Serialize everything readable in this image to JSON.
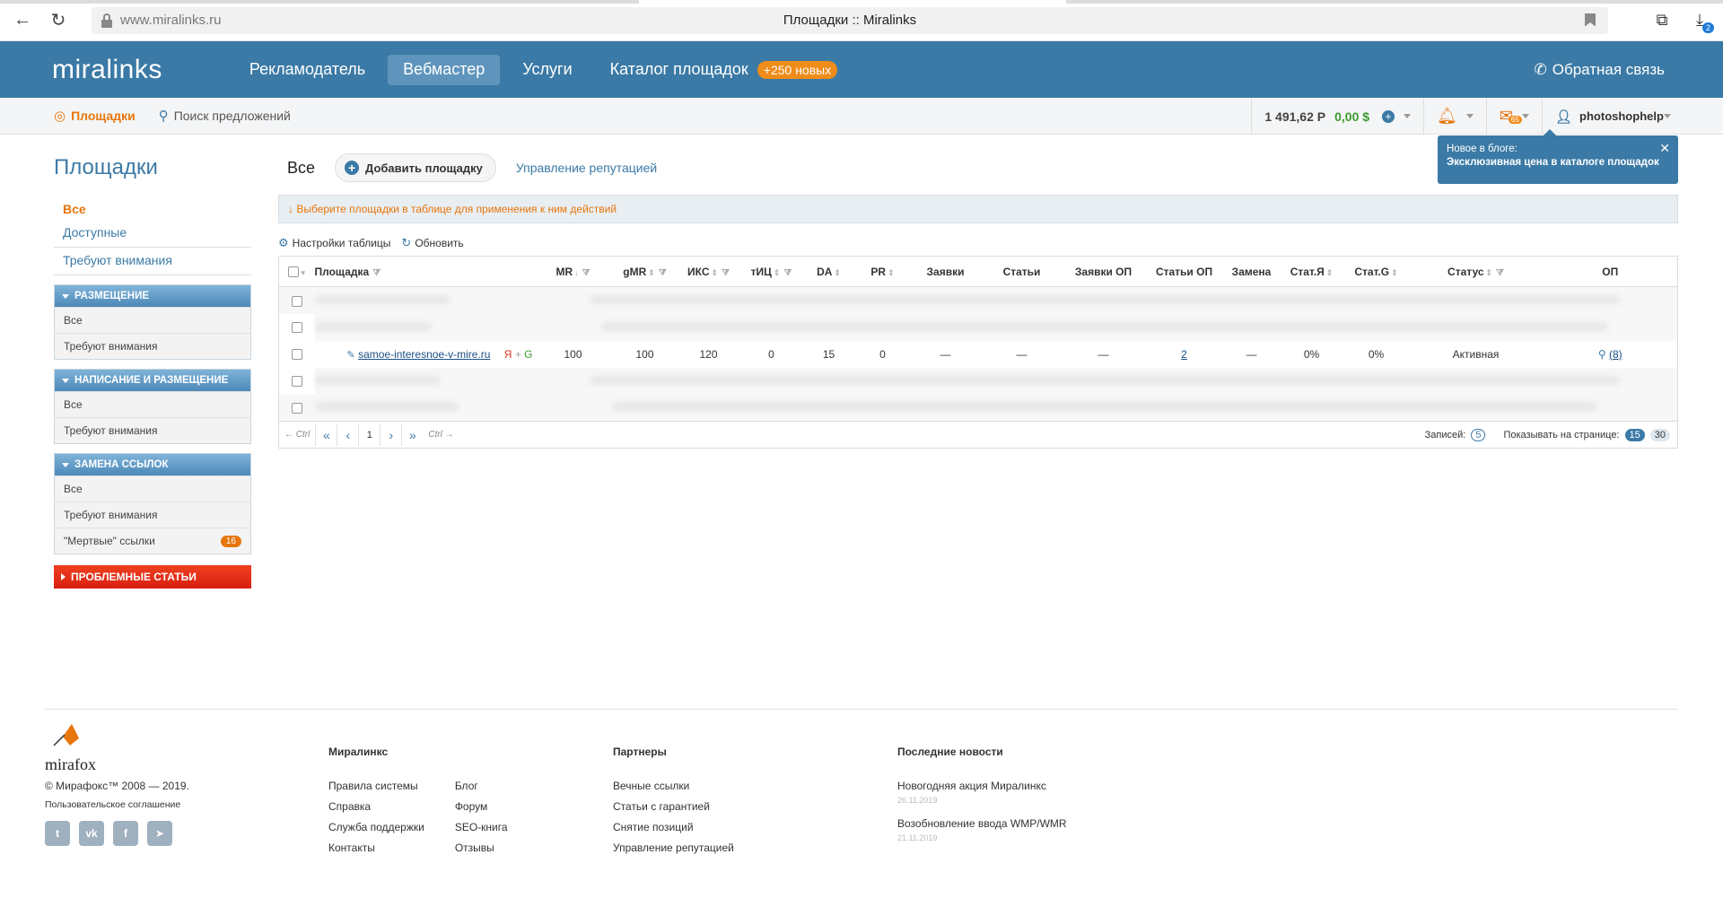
{
  "browser": {
    "url": "www.miralinks.ru",
    "title": "Площадки :: Miralinks",
    "download_count": "2"
  },
  "topnav": {
    "logo": "miralinks",
    "items": [
      {
        "label": "Рекламодатель"
      },
      {
        "label": "Вебмастер"
      },
      {
        "label": "Услуги"
      },
      {
        "label": "Каталог площадок"
      }
    ],
    "new_badge": "+250 новых",
    "feedback": "Обратная связь"
  },
  "subnav": {
    "places": "Площадки",
    "search": "Поиск предложений",
    "balance_rub": "1 491,62 Р",
    "balance_usd": "0,00 $",
    "mail_count": "65",
    "user": "photoshophelp"
  },
  "blog_popup": {
    "line1": "Новое в блоге:",
    "line2": "Эксклюзивная цена в каталоге площадок",
    "close": "✕"
  },
  "sidebar": {
    "title": "Площадки",
    "links": [
      "Все",
      "Доступные",
      "Требуют внимания"
    ],
    "groups": [
      {
        "title": "Размещение",
        "rows": [
          "Все",
          "Требуют внимания"
        ]
      },
      {
        "title": "Написание и размещение",
        "rows": [
          "Все",
          "Требуют внимания"
        ]
      },
      {
        "title": "Замена ссылок",
        "rows": [
          "Все",
          "Требуют внимания",
          "\"Мертвые\" ссылки"
        ],
        "dead_count": "16"
      }
    ],
    "problem": "Проблемные статьи"
  },
  "main": {
    "tab_all": "Все",
    "add_button": "Добавить площадку",
    "reputation": "Управление репутацией",
    "hint": "↓ Выберите площадки в таблице для применения к ним действий",
    "tools": {
      "settings": "Настройки таблицы",
      "refresh": "Обновить"
    },
    "columns": [
      "Площадка",
      "MR",
      "gMR",
      "ИКС",
      "тИЦ",
      "DA",
      "PR",
      "Заявки",
      "Статьи",
      "Заявки ОП",
      "Статьи ОП",
      "Замена",
      "Стат.Я",
      "Стат.G",
      "Статус",
      "ОП"
    ],
    "row": {
      "site": "samoe-interesnoe-v-mire.ru",
      "engines_y": "Я",
      "engines_plus": "+",
      "engines_g": "G",
      "mr": "100",
      "gmr": "100",
      "iks": "120",
      "tic": "0",
      "da": "15",
      "pr": "0",
      "orders": "—",
      "articles": "—",
      "orders_op": "—",
      "articles_op": "2",
      "replace": "—",
      "stat_y": "0%",
      "stat_g": "0%",
      "status": "Активная",
      "op": "(8)"
    },
    "pager": {
      "ctrl_left": "← Ctrl",
      "first": "«",
      "prev": "‹",
      "page": "1",
      "next": "›",
      "last": "»",
      "ctrl_right": "Ctrl →",
      "records_label": "Записей:",
      "records": "5",
      "per_page_label": "Показывать на странице:",
      "per_page_a": "15",
      "per_page_b": "30"
    }
  },
  "footer": {
    "logo": "mirafox",
    "copyright": "© Мирафокс™ 2008 — 2019.",
    "agreement": "Пользовательское соглашение",
    "col1_title": "Миралинкс",
    "col1a": [
      "Правила системы",
      "Справка",
      "Служба поддержки",
      "Контакты"
    ],
    "col1b": [
      "Блог",
      "Форум",
      "SEO-книга",
      "Отзывы"
    ],
    "col2_title": "Партнеры",
    "col2": [
      "Вечные ссылки",
      "Статьи с гарантией",
      "Снятие позиций",
      "Управление репутацией"
    ],
    "col3_title": "Последние новости",
    "news": [
      {
        "title": "Новогодняя акция Миралинкс",
        "date": "26.11.2019"
      },
      {
        "title": "Возобновление ввода WMP/WMR",
        "date": "21.11.2019"
      }
    ]
  }
}
